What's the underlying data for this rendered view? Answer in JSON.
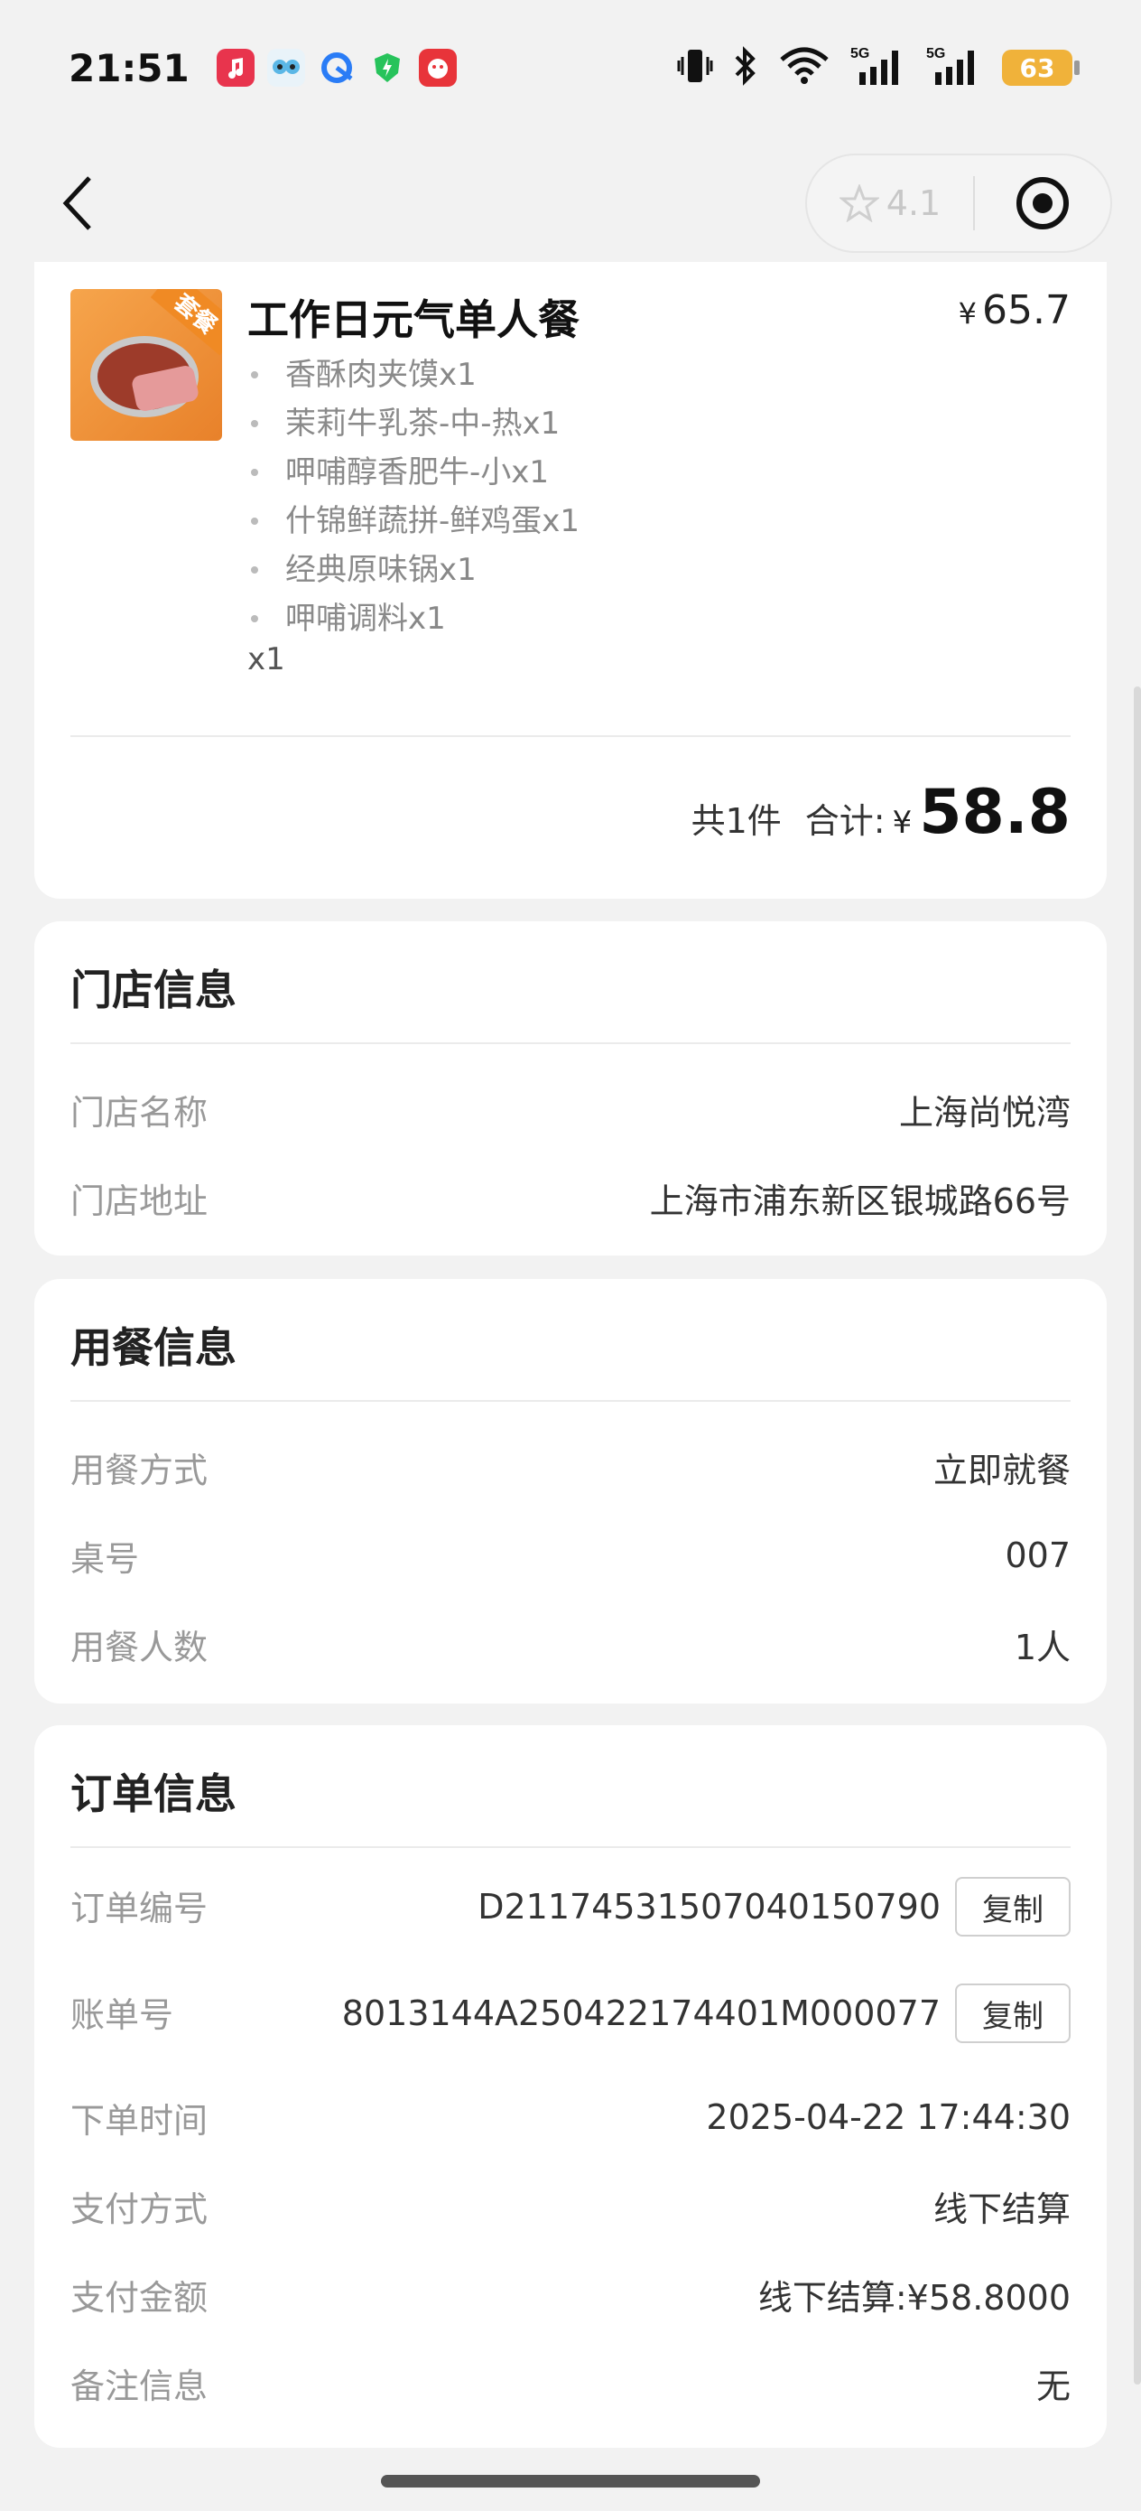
{
  "status_bar": {
    "time": "21:51",
    "battery": "63",
    "icons": [
      "music-app-icon",
      "owl-app-icon",
      "browser-icon",
      "shield-icon",
      "red-app-icon",
      "vibrate-icon",
      "bluetooth-icon",
      "wifi-icon",
      "5g-signal-icon",
      "5g-signal-icon"
    ]
  },
  "nav": {
    "rating": "4.1"
  },
  "product": {
    "title": "工作日元气单人餐",
    "price_symbol": "¥",
    "price": "65.7",
    "thumb_tag": "套餐",
    "items": [
      {
        "name": "香酥肉夹馍",
        "qty": "x1"
      },
      {
        "name": "茉莉牛乳茶-中-热",
        "qty": "x1"
      },
      {
        "name": "呷哺醇香肥牛-小",
        "qty": "x1"
      },
      {
        "name": "什锦鲜蔬拼-鲜鸡蛋",
        "qty": "x1"
      },
      {
        "name": "经典原味锅",
        "qty": "x1"
      },
      {
        "name": "呷哺调料",
        "qty": "x1"
      }
    ],
    "qty": "x1"
  },
  "total": {
    "count": "共1件",
    "label": "合计:",
    "symbol": "¥",
    "amount": "58.8"
  },
  "store": {
    "title": "门店信息",
    "rows": [
      {
        "label": "门店名称",
        "value": "上海尚悦湾"
      },
      {
        "label": "门店地址",
        "value": "上海市浦东新区银城路66号"
      }
    ]
  },
  "dining": {
    "title": "用餐信息",
    "rows": [
      {
        "label": "用餐方式",
        "value": "立即就餐"
      },
      {
        "label": "桌号",
        "value": "007"
      },
      {
        "label": "用餐人数",
        "value": "1人"
      }
    ]
  },
  "order": {
    "title": "订单信息",
    "copy_label": "复制",
    "order_no_label": "订单编号",
    "order_no": "D21174531507040150790",
    "bill_no_label": "账单号",
    "bill_no": "8013144A250422174401M000077",
    "rows": [
      {
        "label": "下单时间",
        "value": "2025-04-22 17:44:30"
      },
      {
        "label": "支付方式",
        "value": "线下结算"
      },
      {
        "label": "支付金额",
        "value": "线下结算:¥58.8000"
      },
      {
        "label": "备注信息",
        "value": "无"
      }
    ]
  },
  "colors": {
    "background": "#f2f2f2",
    "card": "#ffffff",
    "battery": "#f0b23a",
    "thumb": "#f08a24"
  }
}
